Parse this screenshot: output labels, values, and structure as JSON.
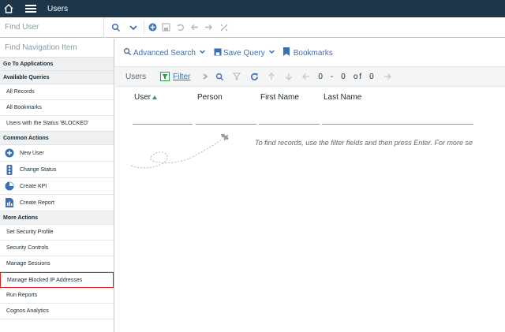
{
  "topbar": {
    "title": "Users",
    "home_icon": "home-icon",
    "menu_icon": "hamburger-menu-icon"
  },
  "searchbar": {
    "find_user_placeholder": "Find User",
    "icons": [
      "search-icon",
      "chevron-down-icon",
      "add-icon",
      "save-icon",
      "undo-icon",
      "back-arrow-icon",
      "forward-arrow-icon",
      "link-icon"
    ]
  },
  "sidebar": {
    "nav_search_placeholder": "Find Navigation Item",
    "go_to_apps": "Go To Applications",
    "available_queries": {
      "heading": "Available Queries",
      "items": [
        "All Records",
        "All Bookmarks",
        "Users with the Status 'BLOCKED'"
      ]
    },
    "common_actions": {
      "heading": "Common Actions",
      "items": [
        {
          "label": "New User",
          "icon": "plus-circle-icon"
        },
        {
          "label": "Change Status",
          "icon": "traffic-light-icon"
        },
        {
          "label": "Create KPI",
          "icon": "kpi-gauge-icon"
        },
        {
          "label": "Create Report",
          "icon": "report-icon"
        }
      ]
    },
    "more_actions": {
      "heading": "More Actions",
      "items": [
        "Set Security Profile",
        "Security Controls",
        "Manage Sessions",
        "Manage Blocked IP Addresses",
        "Run Reports",
        "Cognos Analytics"
      ]
    }
  },
  "main": {
    "advanced_search": "Advanced Search",
    "save_query": "Save Query",
    "bookmarks": "Bookmarks",
    "list_title": "Users",
    "filter_label": "Filter",
    "pager": {
      "start": "0",
      "dash": "-",
      "end": "0",
      "of": "of",
      "total": "0"
    },
    "columns": [
      "User",
      "Person",
      "First Name",
      "Last Name"
    ],
    "empty_message": "To find records, use the filter fields and then press Enter. For more se"
  },
  "colors": {
    "topbar": "#1d3649",
    "link": "#3d70b2",
    "highlight_border": "#e02020"
  }
}
